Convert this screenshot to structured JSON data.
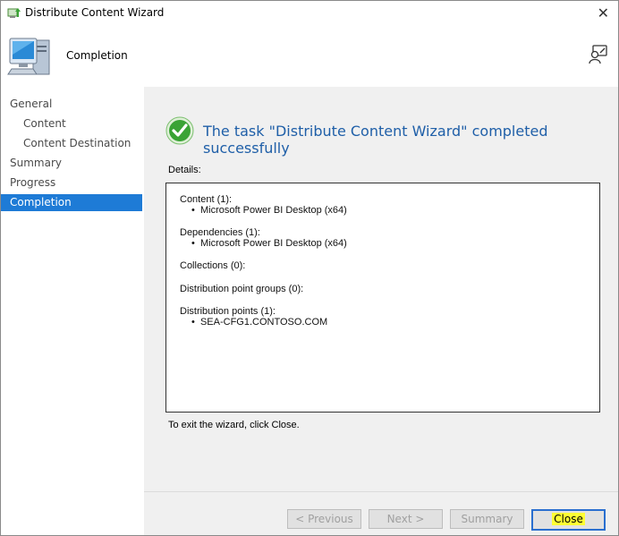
{
  "window": {
    "title": "Distribute Content Wizard",
    "close_glyph": "✕",
    "icon": "distribute-content-icon"
  },
  "header": {
    "title": "Completion",
    "graphic": "computer-icon",
    "help_icon": "help-person-icon"
  },
  "sidebar": {
    "items": [
      {
        "label": "General",
        "level": 0,
        "active": false
      },
      {
        "label": "Content",
        "level": 1,
        "active": false
      },
      {
        "label": "Content Destination",
        "level": 1,
        "active": false
      },
      {
        "label": "Summary",
        "level": 0,
        "active": false
      },
      {
        "label": "Progress",
        "level": 0,
        "active": false
      },
      {
        "label": "Completion",
        "level": 0,
        "active": true
      }
    ],
    "active_color": "#1e7bd6"
  },
  "main": {
    "status_icon": "success-check-icon",
    "status_text": "The task \"Distribute Content Wizard\" completed successfully",
    "details_label": "Details:",
    "details": {
      "content_heading": "Content (1):",
      "content_item": "Microsoft Power BI Desktop (x64)",
      "dependencies_heading": "Dependencies (1):",
      "dependencies_item": "Microsoft Power BI Desktop (x64)",
      "collections_heading": "Collections (0):",
      "dp_groups_heading": "Distribution point groups (0):",
      "dp_heading": "Distribution points (1):",
      "dp_item": "SEA-CFG1.CONTOSO.COM"
    },
    "exit_text": "To exit the wizard, click Close."
  },
  "footer": {
    "previous": "< Previous",
    "next": "Next >",
    "summary": "Summary",
    "close": "Close"
  },
  "colors": {
    "title_blue": "#1f5fa8",
    "success_green": "#3aa335",
    "highlight": "#ffff33"
  }
}
